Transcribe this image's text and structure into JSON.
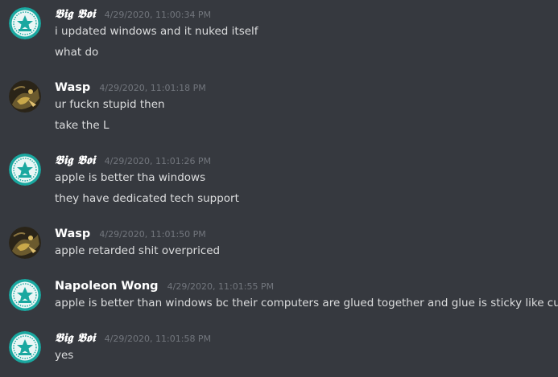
{
  "channel": {
    "messages": [
      {
        "author": "𝕭𝖎𝖌 𝕭𝖔𝖎",
        "avatar_icon": "server-emblem-avatar-icon",
        "timestamp": "4/29/2020, 11:00:34 PM",
        "lines": [
          "i updated windows and it nuked itself",
          "what do"
        ]
      },
      {
        "author": "Wasp",
        "avatar_icon": "bird-artwork-avatar-icon",
        "timestamp": "4/29/2020, 11:01:18 PM",
        "lines": [
          "ur fuckn stupid then",
          "take the L"
        ]
      },
      {
        "author": "𝕭𝖎𝖌 𝕭𝖔𝖎",
        "avatar_icon": "server-emblem-avatar-icon",
        "timestamp": "4/29/2020, 11:01:26 PM",
        "lines": [
          "apple is better tha windows",
          "they have dedicated tech support"
        ]
      },
      {
        "author": "Wasp",
        "avatar_icon": "bird-artwork-avatar-icon",
        "timestamp": "4/29/2020, 11:01:50 PM",
        "lines": [
          "apple retarded shit overpriced"
        ]
      },
      {
        "author": "Napoleon Wong",
        "avatar_icon": "server-emblem-avatar-icon",
        "timestamp": "4/29/2020, 11:01:55 PM",
        "lines": [
          "apple is better than windows bc their computers are glued together and glue is sticky like cum"
        ]
      },
      {
        "author": "𝕭𝖎𝖌 𝕭𝖔𝖎",
        "avatar_icon": "server-emblem-avatar-icon",
        "timestamp": "4/29/2020, 11:01:58 PM",
        "lines": [
          "yes"
        ]
      }
    ]
  },
  "colors": {
    "background": "#36393f",
    "username": "#ffffff",
    "message_text": "#dcddde",
    "timestamp": "#72767d",
    "emblem_teal": "#1aa8a0"
  }
}
